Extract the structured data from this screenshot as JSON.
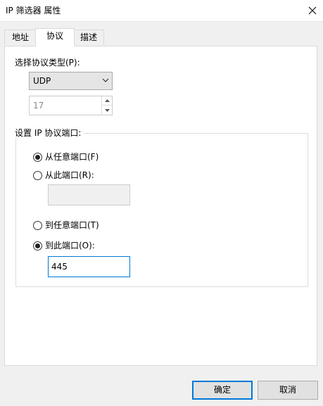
{
  "window": {
    "title": "IP 筛选器 属性",
    "close_icon": "close-icon"
  },
  "tabs": [
    {
      "label": "地址",
      "active": false
    },
    {
      "label": "协议",
      "active": true
    },
    {
      "label": "描述",
      "active": false
    }
  ],
  "protocol": {
    "type_label": "选择协议类型(P):",
    "type_value": "UDP",
    "number_value": "17"
  },
  "ports": {
    "group_label": "设置 IP 协议端口:",
    "from_any_label": "从任意端口(F)",
    "from_this_label": "从此端口(R):",
    "from_port_value": "",
    "to_any_label": "到任意端口(T)",
    "to_this_label": "到此端口(O):",
    "to_port_value": "445"
  },
  "buttons": {
    "ok_label": "确定",
    "cancel_label": "取消"
  },
  "colors": {
    "focus_accent": "#0078d7",
    "window_bg": "#f0f0f0",
    "panel_bg": "#ffffff"
  }
}
